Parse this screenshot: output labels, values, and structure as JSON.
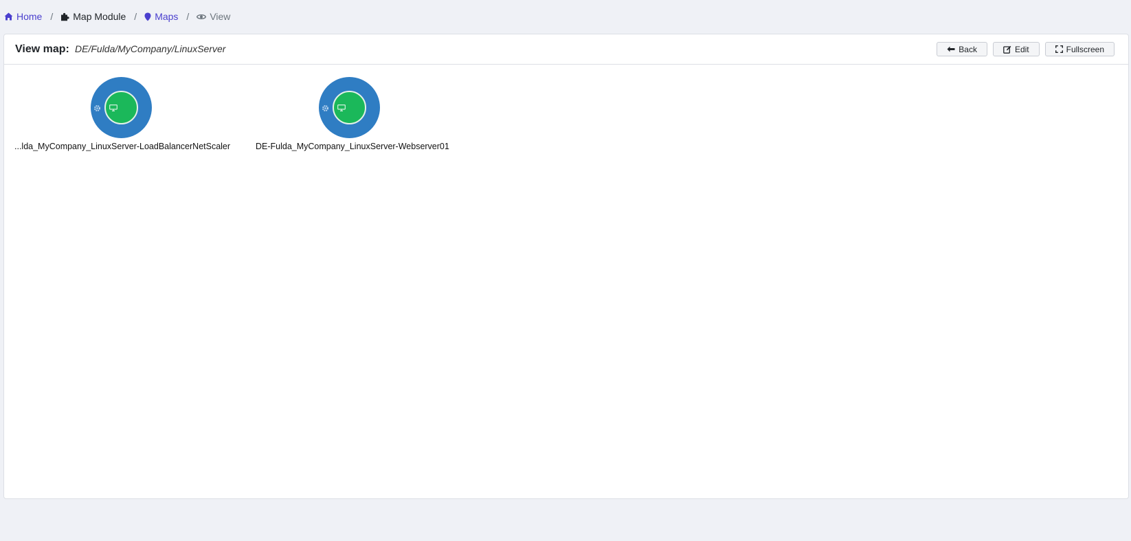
{
  "breadcrumb": {
    "home": "Home",
    "module": "Map Module",
    "maps": "Maps",
    "current": "View",
    "separator": "/",
    "icons": [
      "home-icon",
      "puzzle-icon",
      "map-marker-icon",
      "eye-icon"
    ]
  },
  "card": {
    "title_label": "View map:",
    "map_name": "DE/Fulda/MyCompany/LinuxServer",
    "buttons": {
      "back": "Back",
      "edit": "Edit",
      "fullscreen": "Fullscreen"
    }
  },
  "nodes": [
    {
      "label": "...lda_MyCompany_LinuxServer-LoadBalancerNetScaler",
      "status": "ok",
      "type": "host",
      "icons": [
        "gear-icon",
        "desktop-icon"
      ]
    },
    {
      "label": "DE-Fulda_MyCompany_LinuxServer-Webserver01",
      "status": "ok",
      "type": "host",
      "icons": [
        "gear-icon",
        "desktop-icon"
      ]
    }
  ],
  "colors": {
    "page_background": "#eff1f6",
    "link": "#4a3fce",
    "node_outer": "#2f7dc3",
    "node_inner_ok": "#1bb85a"
  }
}
